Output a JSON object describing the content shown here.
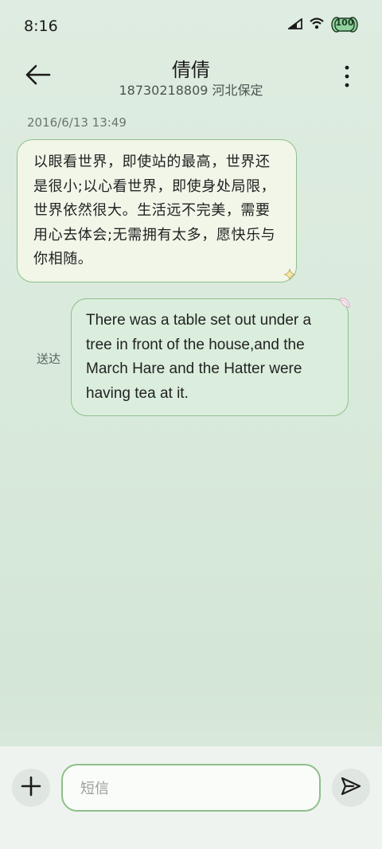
{
  "status_bar": {
    "time": "8:16",
    "battery_level": "100"
  },
  "header": {
    "contact_name": "倩倩",
    "contact_detail": "18730218809 河北保定"
  },
  "messages": {
    "timestamp": "2016/6/13 13:49",
    "incoming_text": "以眼看世界，即使站的最高，世界还是很小;以心看世界，即使身处局限，世界依然很大。生活远不完美，需要用心去体会;无需拥有太多，愿快乐与你相随。",
    "outgoing_text": "There was a table set out under a tree in front of the house,and the March Hare and the Hatter were having tea at it.",
    "outgoing_status": "送达"
  },
  "composer": {
    "placeholder": "短信"
  },
  "colors": {
    "accent": "#8fbf8a",
    "incoming_bubble": "#f1f6e8",
    "outgoing_bubble": "#dbeedd"
  }
}
